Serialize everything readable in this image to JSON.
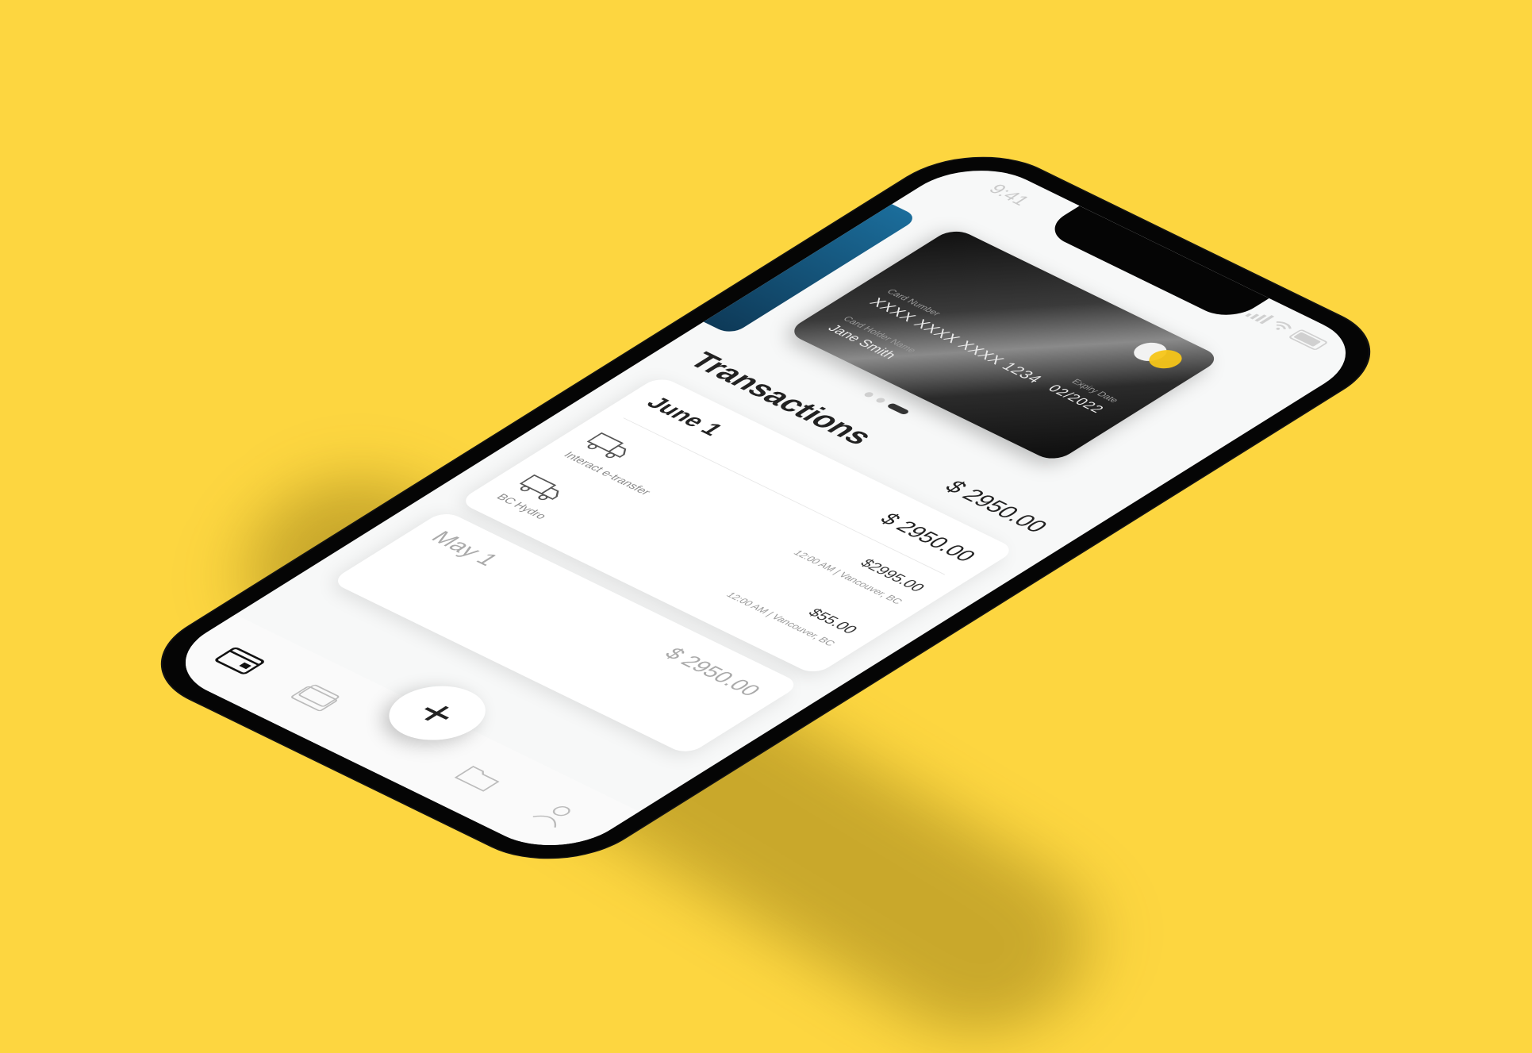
{
  "status_bar": {
    "time": "9:41"
  },
  "card": {
    "number_label": "Card Number",
    "number": "XXXX XXXX XXXX 1234",
    "holder_label": "Card Holder Name",
    "holder": "Jane Smith",
    "expiry_label": "Expiry Date",
    "expiry": "02/2022"
  },
  "carousel": {
    "pages": 3,
    "active_index": 2
  },
  "transactions": {
    "title": "Transactions",
    "total": "$ 2950.00",
    "groups": [
      {
        "date": "June 1",
        "total": "$ 2950.00",
        "items": [
          {
            "name": "Interact e-transfer",
            "amount": "$2995.00",
            "meta": "12:00 AM | Vancouver, BC",
            "icon": "truck-icon"
          },
          {
            "name": "BC Hydro",
            "amount": "$55.00",
            "meta": "12:00 AM | Vancouver, BC",
            "icon": "truck-icon"
          }
        ]
      },
      {
        "date": "May 1",
        "total": "$ 2950.00",
        "items": []
      }
    ]
  },
  "bottom_nav": {
    "items": [
      {
        "icon": "wallet-icon",
        "active": true
      },
      {
        "icon": "cards-stack-icon",
        "active": false
      },
      {
        "icon": "add-icon",
        "active": false
      },
      {
        "icon": "folder-icon",
        "active": false
      },
      {
        "icon": "user-icon",
        "active": false
      }
    ],
    "fab_label": "+"
  },
  "colors": {
    "background": "#FDD640",
    "phone": "#050505",
    "screen": "#F7F8F8",
    "card_accent": "#F5C518",
    "text_dark": "#222222"
  }
}
